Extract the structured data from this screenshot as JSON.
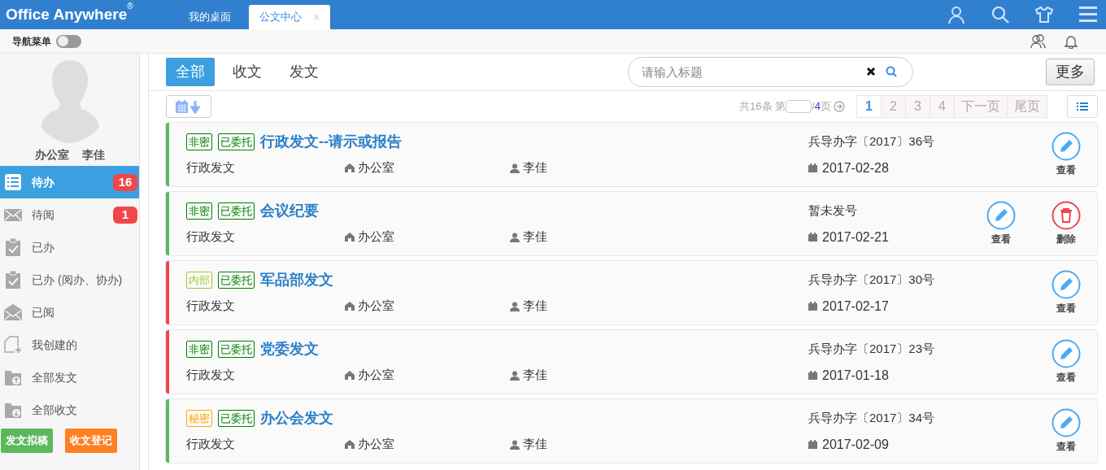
{
  "header": {
    "logo": "Office Anywhere",
    "logo_mark": "®",
    "tabs": [
      {
        "label": "我的桌面",
        "selected": false
      },
      {
        "label": "公文中心",
        "selected": true,
        "close": "×"
      }
    ]
  },
  "subbar": {
    "nav_label": "导航菜单",
    "nav_on": false
  },
  "sidebar": {
    "dept": "办公室",
    "user": "李佳",
    "items": [
      {
        "label": "待办",
        "kind": "list",
        "badge": "16",
        "selected": true
      },
      {
        "label": "待阅",
        "kind": "mail",
        "badge": "1",
        "selected": false
      },
      {
        "label": "已办",
        "kind": "clip",
        "selected": false
      },
      {
        "label": "已办 (阅办、协办)",
        "kind": "clip",
        "selected": false
      },
      {
        "label": "已阅",
        "kind": "mailopen",
        "selected": false
      },
      {
        "label": "我创建的",
        "kind": "newdoc",
        "selected": false
      },
      {
        "label": "全部发文",
        "kind": "folderup",
        "selected": false
      },
      {
        "label": "全部收文",
        "kind": "folderdown",
        "selected": false
      }
    ],
    "buttons": [
      {
        "label": "发文拟稿",
        "color": "#5cb85c"
      },
      {
        "label": "收文登记",
        "color": "#ff7f24"
      }
    ]
  },
  "filters": [
    {
      "label": "全部",
      "selected": true
    },
    {
      "label": "收文",
      "selected": false
    },
    {
      "label": "发文",
      "selected": false
    }
  ],
  "search": {
    "placeholder": "请输入标题"
  },
  "more_button": "更多",
  "pager": {
    "total": "共16条 第",
    "slash": "/",
    "count": "4",
    "suffix": "页",
    "pages": [
      {
        "label": "1",
        "selected": true
      },
      {
        "label": "2",
        "selected": false
      },
      {
        "label": "3",
        "selected": false
      },
      {
        "label": "4",
        "selected": false
      },
      {
        "label": "下一页",
        "selected": false
      },
      {
        "label": "尾页",
        "selected": false
      }
    ]
  },
  "documents": [
    {
      "color": "#5cb85c",
      "tags": [
        {
          "label": "非密",
          "color": "#008000"
        },
        {
          "label": "已委托",
          "color": "#008000"
        }
      ],
      "title": "行政发文--请示或报告",
      "category": "行政发文",
      "dept": "办公室",
      "person": "李佳",
      "number": "兵导办字〔2017〕36号",
      "date": "2017-02-28",
      "actions": [
        {
          "kind": "view",
          "label": "查看"
        }
      ]
    },
    {
      "color": "#5cb85c",
      "tags": [
        {
          "label": "非密",
          "color": "#008000"
        },
        {
          "label": "已委托",
          "color": "#008000"
        }
      ],
      "title": "会议纪要",
      "category": "行政发文",
      "dept": "办公室",
      "person": "李佳",
      "number": "暂未发号",
      "date": "2017-02-21",
      "actions": [
        {
          "kind": "view",
          "label": "查看"
        },
        {
          "kind": "delete",
          "label": "删除"
        }
      ]
    },
    {
      "color": "#f0474b",
      "tags": [
        {
          "label": "内部",
          "color": "#9acd32"
        },
        {
          "label": "已委托",
          "color": "#008000"
        }
      ],
      "title": "军品部发文",
      "category": "行政发文",
      "dept": "办公室",
      "person": "李佳",
      "number": "兵导办字〔2017〕30号",
      "date": "2017-02-17",
      "actions": [
        {
          "kind": "view",
          "label": "查看"
        }
      ]
    },
    {
      "color": "#f0474b",
      "tags": [
        {
          "label": "非密",
          "color": "#008000"
        },
        {
          "label": "已委托",
          "color": "#008000"
        }
      ],
      "title": "党委发文",
      "category": "行政发文",
      "dept": "办公室",
      "person": "李佳",
      "number": "兵导办字〔2017〕23号",
      "date": "2017-01-18",
      "actions": [
        {
          "kind": "view",
          "label": "查看"
        }
      ]
    },
    {
      "color": "#5cb85c",
      "tags": [
        {
          "label": "秘密",
          "color": "#ffa500"
        },
        {
          "label": "已委托",
          "color": "#008000"
        }
      ],
      "title": "办公会发文",
      "category": "行政发文",
      "dept": "办公室",
      "person": "李佳",
      "number": "兵导办字〔2017〕34号",
      "date": "2017-02-09",
      "actions": [
        {
          "kind": "view",
          "label": "查看"
        }
      ]
    }
  ]
}
